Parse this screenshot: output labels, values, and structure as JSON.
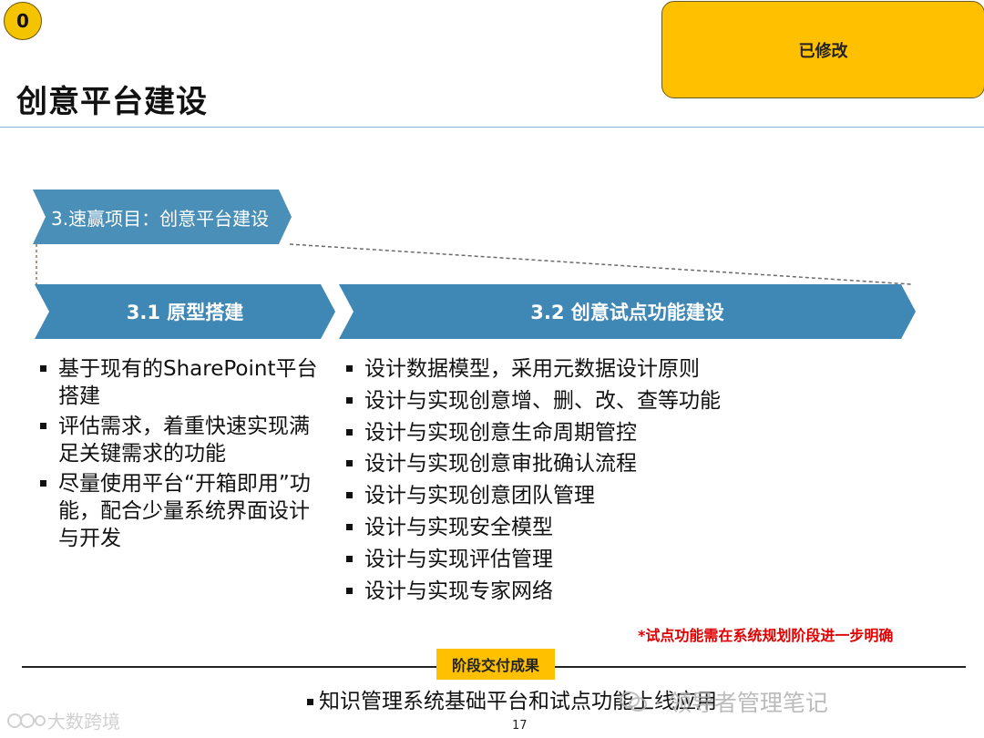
{
  "badge": "0",
  "status_box": "已修改",
  "page_title": "创意平台建设",
  "quick_win": "3.速赢项目：创意平台建设",
  "phases": [
    {
      "title": "3.1 原型搭建",
      "items": [
        "基于现有的SharePoint平台搭建",
        "评估需求，着重快速实现满足关键需求的功能",
        "尽量使用平台“开箱即用”功能，配合少量系统界面设计与开发"
      ]
    },
    {
      "title": "3.2 创意试点功能建设",
      "items": [
        "设计数据模型，采用元数据设计原则",
        "设计与实现创意增、删、改、查等功能",
        "设计与实现创意生命周期管控",
        "设计与实现创意审批确认流程",
        "设计与实现创意团队管理",
        "设计与实现安全模型",
        "设计与实现评估管理",
        "设计与实现专家网络"
      ]
    }
  ],
  "footnote": "*试点功能需在系统规划阶段进一步明确",
  "deliverable": {
    "label": "阶段交付成果",
    "text": "知识管理系统基础平台和试点功能上线应用"
  },
  "watermarks": {
    "right": "· 领导者管理笔记",
    "left": "大数跨境"
  },
  "page_number": "17",
  "colors": {
    "accent_blue": "#3f87b5",
    "highlight_yellow": "#ffc000",
    "warning_red": "#e00000"
  }
}
